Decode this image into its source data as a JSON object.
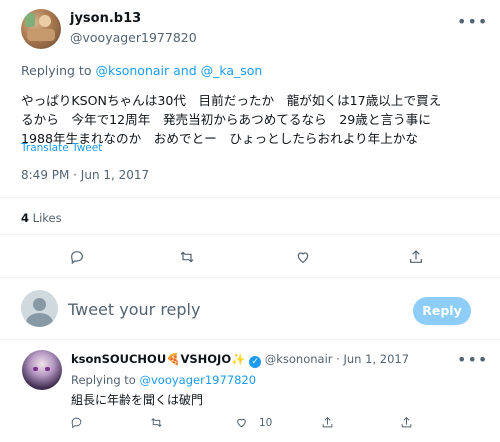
{
  "tweet": {
    "display_name": "jyson.b13",
    "handle": "@vooyager1977820",
    "replying_to_prefix": "Replying to",
    "replying_to_mentions": "@ksononair and @_ka_son",
    "text_lines": [
      "やっぱりKSONちゃんは30代　目前だったか　龍が如くは17歳以上で買え",
      "るから　今年で12周年　発売当初からあつめてるなら　29歳と言う事に",
      "1988年生まれなのか　おめでとー　ひょっとしたらおれより年上かな"
    ],
    "translate_label": "Translate Tweet",
    "timestamp": "8:49 PM · Jun 1, 2017",
    "likes_count": "4",
    "likes_label": "Likes"
  },
  "compose": {
    "placeholder": "Tweet your reply",
    "reply_button": "Reply"
  },
  "reply": {
    "display_name": "ksonSOUCHOU🍕VSHOJO✨",
    "handle": "@ksononair",
    "date": "· Jun 1, 2017",
    "replying_to_prefix": "Replying to",
    "replying_to_mention": "@vooyager1977820",
    "text": "組長に年齢を聞くは破門",
    "like_count": "10"
  },
  "icons": [
    "more-icon",
    "reply-icon",
    "retweet-icon",
    "like-icon",
    "share-icon",
    "verified-icon"
  ],
  "colors": {
    "accent": "#1d9bf0",
    "reply_button": "#8ecdf8",
    "muted": "#536471"
  }
}
